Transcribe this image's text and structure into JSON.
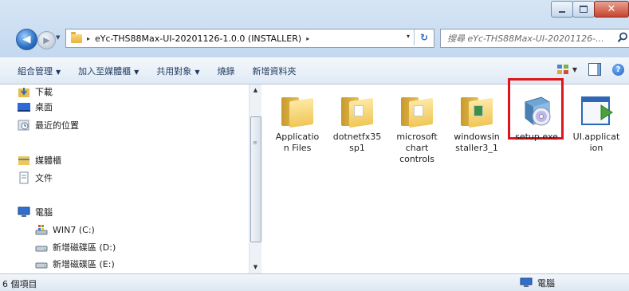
{
  "window": {
    "caption_buttons": {
      "minimize": "minimize",
      "maximize": "maximize",
      "close": "✕"
    }
  },
  "address_bar": {
    "path": "eYc-THS88Max-UI-20201126-1.0.0 (INSTALLER)",
    "separator": "▸",
    "trailing_separator": "▸",
    "dropdown": "▾",
    "refresh": "↻"
  },
  "search": {
    "placeholder": "搜尋 eYc-THS88Max-UI-20201126-..."
  },
  "toolbar": {
    "organize": "組合管理",
    "include_in_library": "加入至媒體櫃",
    "share_with": "共用對象",
    "burn": "燒錄",
    "new_folder": "新增資料夾",
    "arrow": "▼",
    "help": "?"
  },
  "navigation": {
    "items": [
      {
        "label": "下載",
        "icon": "downloads-icon"
      },
      {
        "label": "桌面",
        "icon": "desktop-icon"
      },
      {
        "label": "最近的位置",
        "icon": "recent-places-icon"
      },
      {
        "label": "媒體櫃",
        "icon": "libraries-icon"
      },
      {
        "label": "文件",
        "icon": "documents-icon"
      },
      {
        "label": "電腦",
        "icon": "computer-icon"
      },
      {
        "label": "WIN7 (C:)",
        "icon": "system-drive-icon"
      },
      {
        "label": "新增磁碟區 (D:)",
        "icon": "drive-icon"
      },
      {
        "label": "新增磁碟區 (E:)",
        "icon": "drive-icon"
      }
    ]
  },
  "files": [
    {
      "name": "Application Files",
      "lines": [
        "Applicatio",
        "n Files"
      ],
      "type": "folder"
    },
    {
      "name": "dotnetfx35sp1",
      "lines": [
        "dotnetfx35",
        "sp1"
      ],
      "type": "folder"
    },
    {
      "name": "microsoft chart controls",
      "lines": [
        "microsoft",
        "chart",
        "controls"
      ],
      "type": "folder"
    },
    {
      "name": "windowsinstaller3_1",
      "lines": [
        "windowsin",
        "staller3_1"
      ],
      "type": "folder"
    },
    {
      "name": "setup.exe",
      "lines": [
        "setup.exe"
      ],
      "type": "installer",
      "highlighted": true
    },
    {
      "name": "UI.application",
      "lines": [
        "UI.applicat",
        "ion"
      ],
      "type": "application"
    }
  ],
  "status": {
    "item_count": "6 個項目",
    "zone": "電腦"
  },
  "colors": {
    "highlight": "#e0141b",
    "toolbar_text": "#1e3a5f",
    "folder": "#f0c657"
  }
}
